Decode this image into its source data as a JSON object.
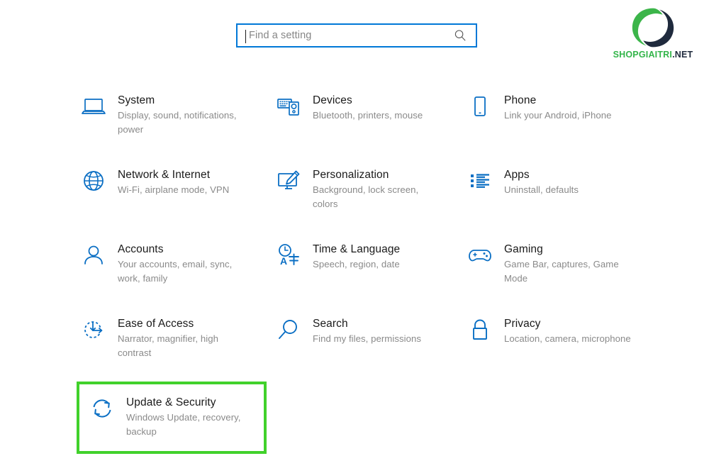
{
  "search": {
    "placeholder": "Find a setting",
    "icon": "search-icon"
  },
  "logo": {
    "text_green": "SHOPGIAITRI",
    "text_dark": ".NET",
    "icon": "swirl-circle-logo",
    "color_green": "#33b54a",
    "color_dark": "#1f2a3d"
  },
  "highlight": {
    "color": "#41d12b",
    "target": "Update & Security"
  },
  "theme": {
    "accent": "#0078d7",
    "title_color": "#1a1a1a",
    "subtitle_color": "#8a8a8a"
  },
  "settings": [
    {
      "icon": "laptop-icon",
      "title": "System",
      "subtitle": "Display, sound, notifications, power"
    },
    {
      "icon": "devices-icon",
      "title": "Devices",
      "subtitle": "Bluetooth, printers, mouse"
    },
    {
      "icon": "phone-icon",
      "title": "Phone",
      "subtitle": "Link your Android, iPhone"
    },
    {
      "icon": "globe-icon",
      "title": "Network & Internet",
      "subtitle": "Wi-Fi, airplane mode, VPN"
    },
    {
      "icon": "paintbrush-icon",
      "title": "Personalization",
      "subtitle": "Background, lock screen, colors"
    },
    {
      "icon": "list-icon",
      "title": "Apps",
      "subtitle": "Uninstall, defaults"
    },
    {
      "icon": "person-icon",
      "title": "Accounts",
      "subtitle": "Your accounts, email, sync, work, family"
    },
    {
      "icon": "clock-language-icon",
      "title": "Time & Language",
      "subtitle": "Speech, region, date"
    },
    {
      "icon": "gamepad-icon",
      "title": "Gaming",
      "subtitle": "Game Bar, captures, Game Mode"
    },
    {
      "icon": "ease-of-access-icon",
      "title": "Ease of Access",
      "subtitle": "Narrator, magnifier, high contrast"
    },
    {
      "icon": "magnifier-icon",
      "title": "Search",
      "subtitle": "Find my files, permissions"
    },
    {
      "icon": "lock-icon",
      "title": "Privacy",
      "subtitle": "Location, camera, microphone"
    },
    {
      "icon": "refresh-icon",
      "title": "Update & Security",
      "subtitle": "Windows Update, recovery, backup"
    }
  ]
}
